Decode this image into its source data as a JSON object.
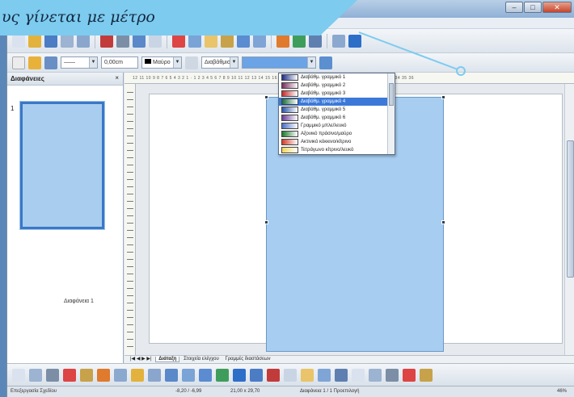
{
  "callout": {
    "text": "υς γίνεται με μέτρο"
  },
  "colors": {
    "callout": "#7dcbef",
    "shape_fill": "#a7cdf0",
    "selection": "#3b78d8"
  },
  "toolbar1": {
    "icons": [
      "new-icon",
      "open-icon",
      "save-icon",
      "email-icon",
      "edit-file-icon",
      "export-pdf-icon",
      "print-icon",
      "spellcheck-icon",
      "autospell-icon",
      "cut-icon",
      "copy-icon",
      "paste-icon",
      "clone-format-icon",
      "undo-icon",
      "redo-icon",
      "chart-icon",
      "globe-icon",
      "navigator-icon",
      "zoom-icon",
      "help-icon"
    ]
  },
  "toolbar2": {
    "line_width": "0,00cm",
    "line_color": "Μαύρο",
    "area_style": "Διαβάθμιση"
  },
  "slides_pane": {
    "title": "Διαφάνειες",
    "close": "×",
    "slide_number": "1",
    "slide_label": "Διαφάνεια 1"
  },
  "ruler": {
    "h_ticks": "12 11 10 9 8 7 6 5 4 3 2 1 · 1 2 3 4 5 6 7 8 9 10 11 12 13 14 15 16 17 18 19 20 21 22 23 24 25 26 27 28 29 30 31 32 33 34 35 36"
  },
  "dropdown": {
    "items": [
      {
        "label": "Διαβάθμ. γραμμικό 1",
        "color": "#1f2f8c",
        "selected": false
      },
      {
        "label": "Διαβάθμ. γραμμικό 2",
        "color": "#7a2c5e",
        "selected": false
      },
      {
        "label": "Διαβάθμ. γραμμικό 3",
        "color": "#c62b2b",
        "selected": false
      },
      {
        "label": "Διαβάθμ. γραμμικό 4",
        "color": "#1c6b3a",
        "selected": true
      },
      {
        "label": "Διαβάθμ. γραμμικό 5",
        "color": "#2a55a8",
        "selected": false
      },
      {
        "label": "Διαβάθμ. γραμμικό 6",
        "color": "#6a3d9a",
        "selected": false
      },
      {
        "label": "Γραμμικό μπλε/λευκό",
        "color": "#4a6fc9",
        "selected": false
      },
      {
        "label": "Αξονικό πράσινο/μαύρο",
        "color": "#1a7a2a",
        "selected": false
      },
      {
        "label": "Ακτινικό κόκκινο/κίτρινο",
        "color": "#d33c2a",
        "selected": false
      },
      {
        "label": "Τετράγωνο κίτρινο/λευκό",
        "color": "#f1d55a",
        "selected": false
      }
    ]
  },
  "tabs": {
    "nav": "|◀ ◀ ▶ ▶|",
    "items": [
      "Διάταξη",
      "Στοιχεία ελέγχου",
      "Γραμμές διαστάσεων"
    ]
  },
  "drawbar": {
    "icons": [
      "select-icon",
      "line-icon",
      "arrow-icon",
      "rectangle-icon",
      "ellipse-icon",
      "text-icon",
      "curve-icon",
      "connector-icon",
      "lines-arrows-icon",
      "basic-shapes-icon",
      "symbol-shapes-icon",
      "block-arrows-icon",
      "flowchart-icon",
      "callouts-icon",
      "stars-icon",
      "points-icon",
      "glue-points-icon",
      "fontwork-icon",
      "from-file-icon",
      "gallery-icon",
      "extrusion-icon",
      "rotate-icon",
      "align-icon",
      "arrange-icon",
      "shadow-icon"
    ]
  },
  "status": {
    "mode": "Επεξεργασία Σχεδίου",
    "position": "-8,20 / -6,99",
    "size": "21,00 x 29,70",
    "slide": "Διαφάνεια 1 / 1 Προεπιλογή",
    "zoom": "46%"
  }
}
